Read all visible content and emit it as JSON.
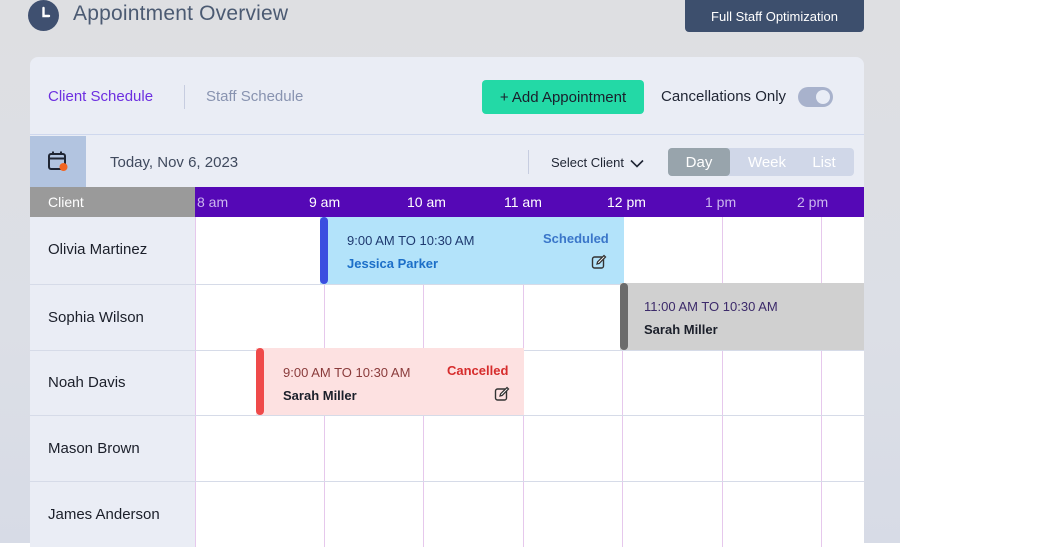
{
  "header": {
    "title": "Appointment Overview",
    "icon": "clock-icon",
    "optimize_label": "Full Staff Optimization"
  },
  "tabs": {
    "client": "Client Schedule",
    "staff": "Staff Schedule"
  },
  "actions": {
    "add_label": "+ Add Appointment",
    "cancellations_label": "Cancellations Only",
    "cancellations_on": true
  },
  "datebar": {
    "date": "Today, Nov 6, 2023",
    "select_client": "Select Client",
    "views": [
      "Day",
      "Week",
      "List"
    ],
    "active_view": "Day"
  },
  "timeline": {
    "client_header": "Client",
    "hours": [
      "8 am",
      "9 am",
      "10 am",
      "11 am",
      "12 pm",
      "1 pm",
      "2 pm"
    ]
  },
  "clients": [
    "Olivia Martinez",
    "Sophia Wilson",
    "Noah Davis",
    "Mason Brown",
    "James Anderson"
  ],
  "appointments": [
    {
      "client": "Olivia Martinez",
      "time": "9:00 AM TO 10:30 AM",
      "staff": "Jessica Parker",
      "status": "Scheduled",
      "color": "#b3e3fa",
      "accent": "#3b4ee0"
    },
    {
      "client": "Sophia Wilson",
      "time": "11:00 AM TO 10:30 AM",
      "staff": "Sarah Miller",
      "status": "",
      "color": "#d0d0d0",
      "accent": "#6b6b6b"
    },
    {
      "client": "Noah Davis",
      "time": "9:00 AM TO 10:30 AM",
      "staff": "Sarah Miller",
      "status": "Cancelled",
      "color": "#fde1e1",
      "accent": "#ef4a4a"
    }
  ],
  "colors": {
    "accent_purple": "#5508b6",
    "primary_green": "#23d9a6",
    "dark_button": "#3d4f6d"
  }
}
